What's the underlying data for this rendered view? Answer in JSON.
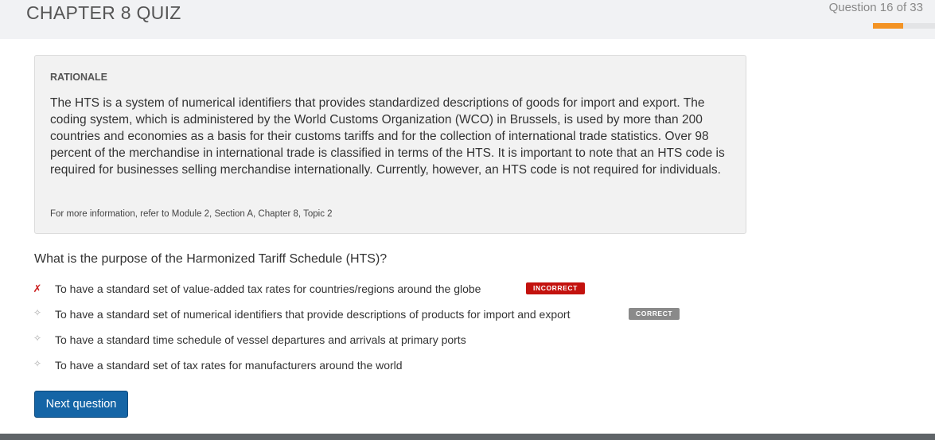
{
  "header": {
    "quiz_title": "CHAPTER 8 QUIZ",
    "progress_text": "Question 16 of 33",
    "progress_fraction": 0.485,
    "accent_color": "#f39324"
  },
  "rationale": {
    "heading": "RATIONALE",
    "body": "The HTS is a system of numerical identifiers that provides standardized descriptions of goods for import and export. The coding system, which is administered by the World Customs Organization (WCO) in Brussels, is used by more than 200 countries and economies as a basis for their customs tariffs and for the collection of international trade statistics. Over 98 percent of the merchandise in international trade is classified in terms of the HTS. It is important to note that an HTS code is required for businesses selling merchandise internationally. Currently, however, an HTS code is not required for individuals.",
    "reference": "For more information, refer to Module 2, Section A, Chapter 8, Topic 2"
  },
  "question": {
    "text": "What is the purpose of the Harmonized Tariff Schedule (HTS)?",
    "answers": [
      {
        "text": "To have a standard set of value-added tax rates for countries/regions around the globe",
        "marker": "✗",
        "badge": "INCORRECT"
      },
      {
        "text": "To have a standard set of numerical identifiers that provide descriptions of products for import and export",
        "marker": "✧",
        "badge": "CORRECT"
      },
      {
        "text": "To have a standard time schedule of vessel departures and arrivals at primary ports",
        "marker": "✧"
      },
      {
        "text": "To have a standard set of tax rates for manufacturers around the world",
        "marker": "✧"
      }
    ]
  },
  "actions": {
    "next_label": "Next question"
  },
  "colors": {
    "incorrect_badge": "#c3120e",
    "correct_badge": "#8a8a8a",
    "primary_button": "#1565a6"
  },
  "icons": {
    "wrong_answer": "x-mark-icon",
    "option": "diamond-bullet-icon"
  }
}
